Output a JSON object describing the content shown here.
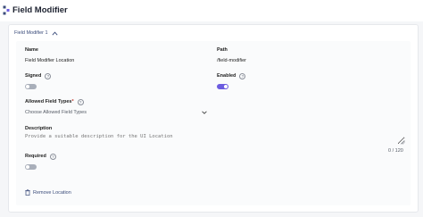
{
  "header": {
    "title": "Field Modifier",
    "icon": "field-modifier-icon"
  },
  "accordion": {
    "label": "Field Modifier 1",
    "expanded": true,
    "icon": "chevron-up-icon"
  },
  "fields": {
    "name": {
      "label": "Name",
      "value": "Field Modifier Location"
    },
    "path": {
      "label": "Path",
      "value": "/field-modifier"
    },
    "signed": {
      "label": "Signed",
      "hint": "?",
      "checked": false
    },
    "enabled": {
      "label": "Enabled",
      "hint": "?",
      "checked": true
    },
    "allowed_types": {
      "label": "Allowed Field Types",
      "required_mark": "*",
      "hint": "?",
      "placeholder": "Choose Allowed Field Types",
      "icon": "chevron-down-icon"
    },
    "description": {
      "label": "Description",
      "placeholder": "Provide a suitable description for the UI Location",
      "counter": "0 / 120"
    },
    "required": {
      "label": "Required",
      "hint": "?",
      "checked": false
    }
  },
  "actions": {
    "remove_label": "Remove Location",
    "remove_icon": "trash-icon"
  },
  "colors": {
    "accent": "#6c5ce0",
    "toggle_off": "#a9afba",
    "link": "#3a4b7a"
  }
}
